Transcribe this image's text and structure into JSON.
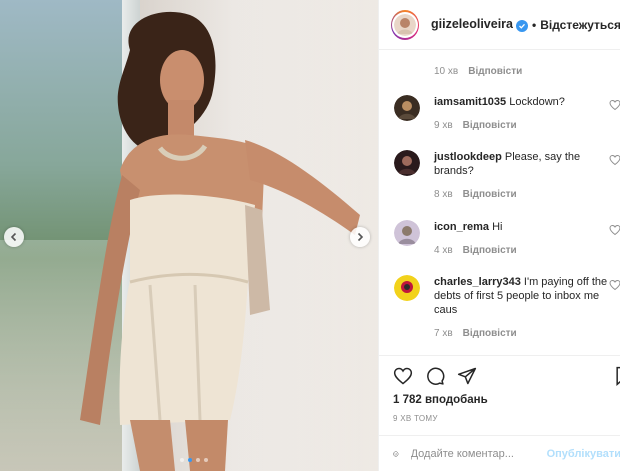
{
  "post": {
    "username": "giizeleoliveira",
    "follow_label": "Відстежуться",
    "follow_separator": "•",
    "likes": "1 782 вподобань",
    "time_ago": "9 ХВ ТОМУ",
    "carousel": {
      "total": 4,
      "active_index": 1
    }
  },
  "comments_panel": {
    "top_meta": {
      "time": "10 хв",
      "reply_label": "Відповісти"
    },
    "comments": [
      {
        "username": "iamsamit1035",
        "text": "Lockdown?",
        "time": "9 хв",
        "reply_label": "Відповісти"
      },
      {
        "username": "justlookdeep",
        "text": "Please, say the brands?",
        "time": "8 хв",
        "reply_label": "Відповісти"
      },
      {
        "username": "icon_rema",
        "text": "Hi",
        "time": "4 хв",
        "reply_label": "Відповісти"
      },
      {
        "username": "charles_larry343",
        "text": "I'm paying off the debts of first 5 people to inbox me caus",
        "time": "7 хв",
        "reply_label": "Відповісти"
      }
    ]
  },
  "comment_box": {
    "placeholder": "Додайте коментар...",
    "publish_label": "Опублікувати"
  },
  "icons": {
    "like": "heart-icon",
    "comment": "comment-icon",
    "share": "paper-plane-icon",
    "save": "bookmark-icon",
    "emoji": "smiley-icon",
    "verified": "verified-badge-icon",
    "prev": "chevron-left-icon",
    "next": "chevron-right-icon"
  },
  "colors": {
    "verified": "#3897f0",
    "muted_text": "#8e8e8e",
    "publish_disabled": "#b2dffc",
    "border": "#efefef"
  }
}
